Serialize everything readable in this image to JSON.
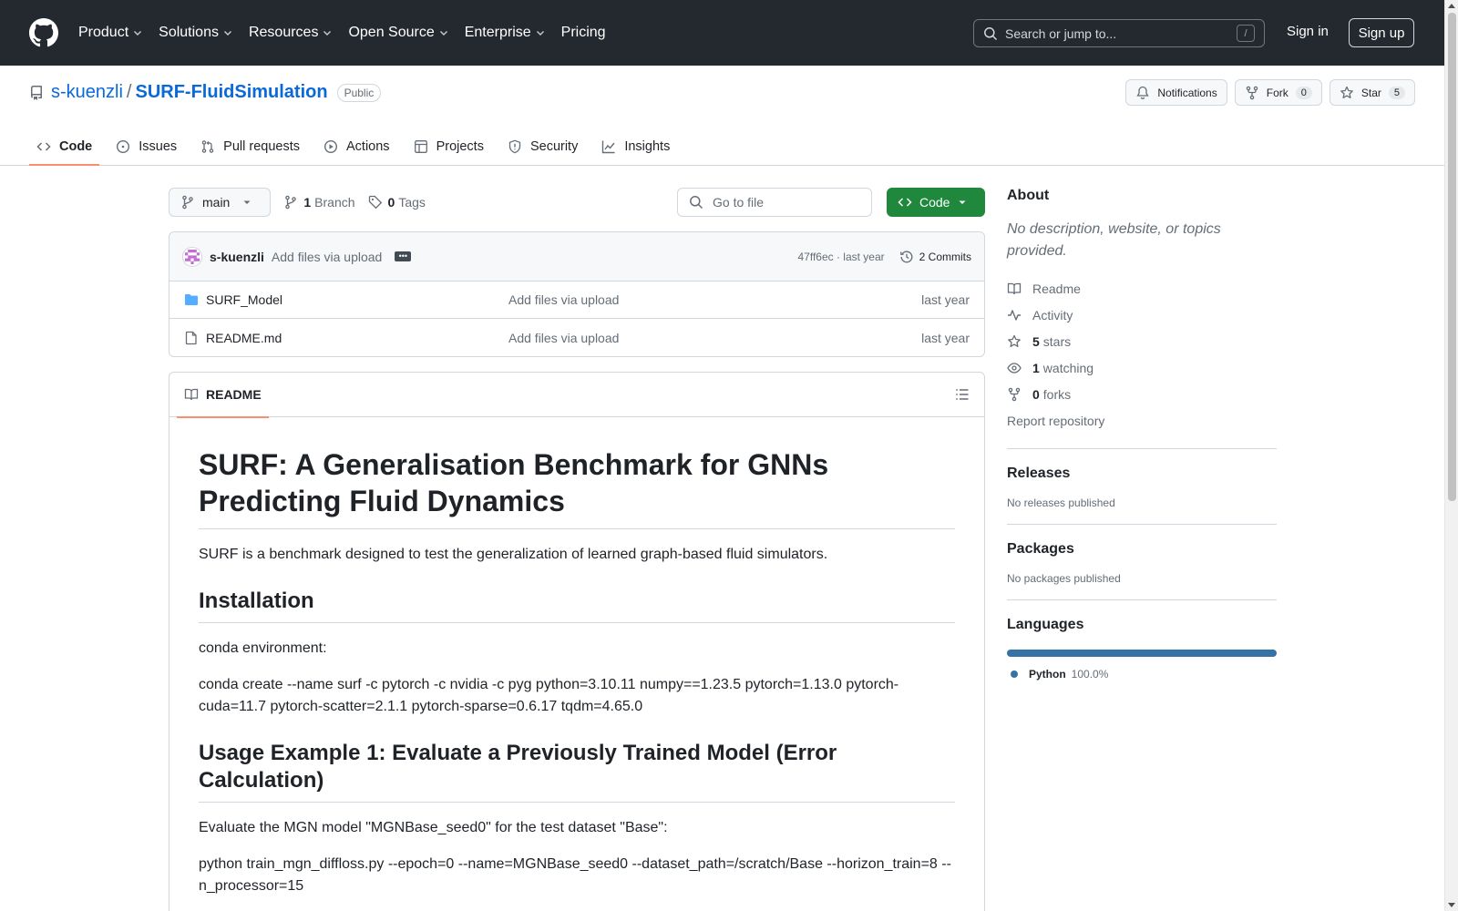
{
  "header": {
    "nav": [
      "Product",
      "Solutions",
      "Resources",
      "Open Source",
      "Enterprise",
      "Pricing"
    ],
    "search_placeholder": "Search or jump to...",
    "search_key": "/",
    "signin": "Sign in",
    "signup": "Sign up"
  },
  "repo": {
    "owner": "s-kuenzli",
    "sep": "/",
    "name": "SURF-FluidSimulation",
    "visibility": "Public",
    "notifications": "Notifications",
    "fork_label": "Fork",
    "fork_count": "0",
    "star_label": "Star",
    "star_count": "5"
  },
  "tabs": [
    "Code",
    "Issues",
    "Pull requests",
    "Actions",
    "Projects",
    "Security",
    "Insights"
  ],
  "toolbar": {
    "branch": "main",
    "branch_count": "1",
    "branch_label": "Branch",
    "tag_count": "0",
    "tag_label": "Tags",
    "goto_placeholder": "Go to file",
    "code_label": "Code"
  },
  "commit": {
    "author": "s-kuenzli",
    "message": "Add files via upload",
    "hash_time": "47ff6ec · last year",
    "commits": "2 Commits"
  },
  "files": [
    {
      "name": "SURF_Model",
      "type": "folder",
      "message": "Add files via upload",
      "date": "last year"
    },
    {
      "name": "README.md",
      "type": "file",
      "message": "Add files via upload",
      "date": "last year"
    }
  ],
  "readme": {
    "tab": "README",
    "h1": "SURF: A Generalisation Benchmark for GNNs Predicting Fluid Dynamics",
    "intro": "SURF is a benchmark designed to test the generalization of learned graph-based fluid simulators.",
    "h2_install": "Installation",
    "conda_env": "conda environment:",
    "conda_cmd": "conda create --name surf -c pytorch -c nvidia -c pyg python=3.10.11 numpy==1.23.5 pytorch=1.13.0 pytorch-cuda=11.7 pytorch-scatter=2.1.1 pytorch-sparse=0.6.17 tqdm=4.65.0",
    "h2_usage1": "Usage Example 1: Evaluate a Previously Trained Model (Error Calculation)",
    "usage1_desc": "Evaluate the MGN model \"MGNBase_seed0\" for the test dataset \"Base\":",
    "usage1_cmd": "python train_mgn_diffloss.py --epoch=0 --name=MGNBase_seed0 --dataset_path=/scratch/Base --horizon_train=8 --n_processor=15"
  },
  "sidebar": {
    "about": "About",
    "about_desc": "No description, website, or topics provided.",
    "readme": "Readme",
    "activity": "Activity",
    "stars_count": "5",
    "stars_label": "stars",
    "watching_count": "1",
    "watching_label": "watching",
    "forks_count": "0",
    "forks_label": "forks",
    "report": "Report repository",
    "releases": "Releases",
    "releases_desc": "No releases published",
    "packages": "Packages",
    "packages_desc": "No packages published",
    "languages": "Languages",
    "lang_name": "Python",
    "lang_pct": "100.0%",
    "lang_color": "#3572a5"
  }
}
